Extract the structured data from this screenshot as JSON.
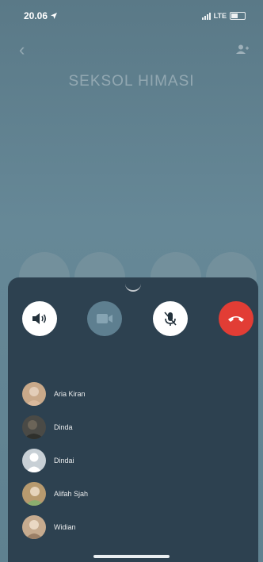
{
  "status_bar": {
    "time": "20.06",
    "network": "LTE"
  },
  "header": {
    "encrypt_text": "",
    "group_name": "SEKSOL HIMASI",
    "subtitle": ""
  },
  "controls": {
    "speaker_icon": "speaker-icon",
    "video_icon": "video-icon",
    "mute_icon": "mute-icon",
    "end_icon": "end-call-icon"
  },
  "participants": [
    {
      "name": "Aria Kiran",
      "color": "#c9a98a"
    },
    {
      "name": "Dinda",
      "color": "#4a4a46"
    },
    {
      "name": "Dindai",
      "color": "#c8d0d6"
    },
    {
      "name": "Alifah Sjah",
      "color": "#b79a6f"
    },
    {
      "name": "Widian",
      "color": "#c6ab8f"
    }
  ],
  "colors": {
    "panel": "#2d4150",
    "end_call": "#e23d35",
    "background": "#668897"
  }
}
